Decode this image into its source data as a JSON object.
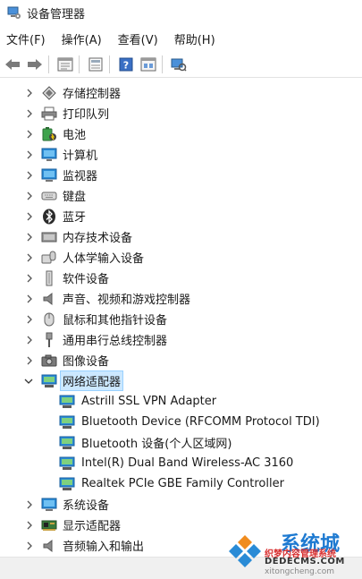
{
  "window": {
    "title": "设备管理器"
  },
  "menu": [
    {
      "label": "文件(F)"
    },
    {
      "label": "操作(A)"
    },
    {
      "label": "查看(V)"
    },
    {
      "label": "帮助(H)"
    }
  ],
  "toolbar": {
    "icons": [
      "back-arrow-icon",
      "forward-arrow-icon",
      "device-list-icon",
      "properties-icon",
      "help-icon",
      "view-icon",
      "scan-hardware-icon"
    ]
  },
  "tree": {
    "categories": [
      {
        "label": "存储控制器",
        "icon": "storage-controller-icon",
        "expanded": false
      },
      {
        "label": "打印队列",
        "icon": "printer-icon",
        "expanded": false
      },
      {
        "label": "电池",
        "icon": "battery-icon",
        "expanded": false
      },
      {
        "label": "计算机",
        "icon": "computer-icon",
        "expanded": false
      },
      {
        "label": "监视器",
        "icon": "monitor-icon",
        "expanded": false
      },
      {
        "label": "键盘",
        "icon": "keyboard-icon",
        "expanded": false
      },
      {
        "label": "蓝牙",
        "icon": "bluetooth-icon",
        "expanded": false
      },
      {
        "label": "内存技术设备",
        "icon": "memory-device-icon",
        "expanded": false
      },
      {
        "label": "人体学输入设备",
        "icon": "hid-icon",
        "expanded": false
      },
      {
        "label": "软件设备",
        "icon": "software-device-icon",
        "expanded": false
      },
      {
        "label": "声音、视频和游戏控制器",
        "icon": "speaker-icon",
        "expanded": false
      },
      {
        "label": "鼠标和其他指针设备",
        "icon": "mouse-icon",
        "expanded": false
      },
      {
        "label": "通用串行总线控制器",
        "icon": "usb-icon",
        "expanded": false
      },
      {
        "label": "图像设备",
        "icon": "camera-icon",
        "expanded": false
      },
      {
        "label": "网络适配器",
        "icon": "network-adapter-icon",
        "expanded": true,
        "selected": true,
        "children": [
          {
            "label": "Astrill SSL VPN Adapter"
          },
          {
            "label": "Bluetooth Device (RFCOMM Protocol TDI)"
          },
          {
            "label": "Bluetooth 设备(个人区域网)"
          },
          {
            "label": "Intel(R) Dual Band Wireless-AC 3160"
          },
          {
            "label": "Realtek PCIe GBE Family Controller"
          }
        ]
      },
      {
        "label": "系统设备",
        "icon": "system-device-icon",
        "expanded": false
      },
      {
        "label": "显示适配器",
        "icon": "display-adapter-icon",
        "expanded": false
      },
      {
        "label": "音频输入和输出",
        "icon": "audio-io-icon",
        "expanded": false
      }
    ]
  },
  "watermark": {
    "main": "系统城",
    "sub": "织梦内容管理系统",
    "domain": "DEDECMS.COM",
    "url": "xitongcheng.com"
  },
  "colors": {
    "selection": "#cce8ff",
    "network_blue": "#2a8bd6",
    "icon_gray": "#5b5b5b"
  }
}
